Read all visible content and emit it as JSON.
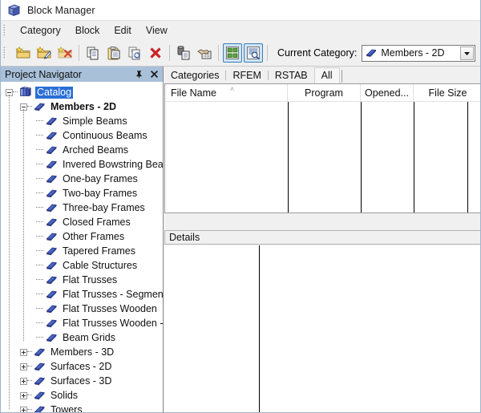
{
  "window": {
    "title": "Block Manager",
    "icon": "block-cabinet-icon"
  },
  "menubar": {
    "items": [
      {
        "label": "Category"
      },
      {
        "label": "Block"
      },
      {
        "label": "Edit"
      },
      {
        "label": "View"
      }
    ]
  },
  "toolbar": {
    "buttons": [
      {
        "name": "new-category-button",
        "icon": "folder-new-icon",
        "pressed": false
      },
      {
        "name": "edit-category-button",
        "icon": "folder-edit-icon",
        "pressed": false
      },
      {
        "name": "delete-category-button",
        "icon": "folder-delete-icon",
        "pressed": false
      },
      {
        "name": "copy-button",
        "icon": "copy-icon",
        "pressed": false
      },
      {
        "name": "paste-button",
        "icon": "paste-icon",
        "pressed": false
      },
      {
        "name": "duplicate-button",
        "icon": "duplicate-icon",
        "pressed": false
      },
      {
        "name": "delete-button",
        "icon": "red-x-icon",
        "pressed": false
      },
      {
        "name": "import-block-button",
        "icon": "block-import-icon",
        "pressed": false
      },
      {
        "name": "export-block-button",
        "icon": "handshake-table-icon",
        "pressed": false
      },
      {
        "name": "thumbnail-view-button",
        "icon": "grid-view-icon",
        "pressed": true
      },
      {
        "name": "details-view-button",
        "icon": "list-search-icon",
        "pressed": true
      }
    ],
    "current_category_label": "Current Category:",
    "current_category_value": "Members - 2D",
    "current_category_icon": "blue-book-icon"
  },
  "navigator": {
    "title": "Project Navigator",
    "pin_icon": "pin-icon",
    "close_icon": "close-icon",
    "tree": [
      {
        "label": "Catalog",
        "depth": 0,
        "icon": "books-stack-icon",
        "expander": "minus",
        "selected": true,
        "bold": false
      },
      {
        "label": "Members - 2D",
        "depth": 1,
        "icon": "blue-book-icon",
        "expander": "minus",
        "selected": false,
        "bold": true
      },
      {
        "label": "Simple Beams",
        "depth": 2,
        "icon": "blue-book-icon",
        "expander": "none",
        "selected": false,
        "bold": false
      },
      {
        "label": "Continuous Beams",
        "depth": 2,
        "icon": "blue-book-icon",
        "expander": "none",
        "selected": false,
        "bold": false
      },
      {
        "label": "Arched Beams",
        "depth": 2,
        "icon": "blue-book-icon",
        "expander": "none",
        "selected": false,
        "bold": false
      },
      {
        "label": "Invered Bowstring Bear",
        "depth": 2,
        "icon": "blue-book-icon",
        "expander": "none",
        "selected": false,
        "bold": false
      },
      {
        "label": "One-bay Frames",
        "depth": 2,
        "icon": "blue-book-icon",
        "expander": "none",
        "selected": false,
        "bold": false
      },
      {
        "label": "Two-bay Frames",
        "depth": 2,
        "icon": "blue-book-icon",
        "expander": "none",
        "selected": false,
        "bold": false
      },
      {
        "label": "Three-bay Frames",
        "depth": 2,
        "icon": "blue-book-icon",
        "expander": "none",
        "selected": false,
        "bold": false
      },
      {
        "label": "Closed Frames",
        "depth": 2,
        "icon": "blue-book-icon",
        "expander": "none",
        "selected": false,
        "bold": false
      },
      {
        "label": "Other Frames",
        "depth": 2,
        "icon": "blue-book-icon",
        "expander": "none",
        "selected": false,
        "bold": false
      },
      {
        "label": "Tapered Frames",
        "depth": 2,
        "icon": "blue-book-icon",
        "expander": "none",
        "selected": false,
        "bold": false
      },
      {
        "label": "Cable Structures",
        "depth": 2,
        "icon": "blue-book-icon",
        "expander": "none",
        "selected": false,
        "bold": false
      },
      {
        "label": "Flat Trusses",
        "depth": 2,
        "icon": "blue-book-icon",
        "expander": "none",
        "selected": false,
        "bold": false
      },
      {
        "label": "Flat Trusses - Segment",
        "depth": 2,
        "icon": "blue-book-icon",
        "expander": "none",
        "selected": false,
        "bold": false
      },
      {
        "label": "Flat Trusses Wooden",
        "depth": 2,
        "icon": "blue-book-icon",
        "expander": "none",
        "selected": false,
        "bold": false
      },
      {
        "label": "Flat Trusses Wooden -",
        "depth": 2,
        "icon": "blue-book-icon",
        "expander": "none",
        "selected": false,
        "bold": false
      },
      {
        "label": "Beam Grids",
        "depth": 2,
        "icon": "blue-book-icon",
        "expander": "none",
        "selected": false,
        "bold": false
      },
      {
        "label": "Members - 3D",
        "depth": 1,
        "icon": "blue-book-icon",
        "expander": "plus",
        "selected": false,
        "bold": false
      },
      {
        "label": "Surfaces - 2D",
        "depth": 1,
        "icon": "blue-book-icon",
        "expander": "plus",
        "selected": false,
        "bold": false
      },
      {
        "label": "Surfaces - 3D",
        "depth": 1,
        "icon": "blue-book-icon",
        "expander": "plus",
        "selected": false,
        "bold": false
      },
      {
        "label": "Solids",
        "depth": 1,
        "icon": "blue-book-icon",
        "expander": "plus",
        "selected": false,
        "bold": false
      },
      {
        "label": "Towers",
        "depth": 1,
        "icon": "blue-book-icon",
        "expander": "plus",
        "selected": false,
        "bold": false
      }
    ]
  },
  "content": {
    "tabs": [
      {
        "label": "Categories",
        "selected": false
      },
      {
        "label": "RFEM",
        "selected": false
      },
      {
        "label": "RSTAB",
        "selected": false
      },
      {
        "label": "All",
        "selected": true
      }
    ],
    "columns": [
      {
        "label": "File Name",
        "sorted": true,
        "sort_caret": "˄"
      },
      {
        "label": "Program",
        "sorted": false,
        "sort_caret": ""
      },
      {
        "label": "Opened...",
        "sorted": false,
        "sort_caret": ""
      },
      {
        "label": "File Size",
        "sorted": false,
        "sort_caret": ""
      }
    ],
    "rows": [],
    "details_title": "Details"
  },
  "colors": {
    "selection_blue": "#2a6fd6",
    "navigator_header": "#a8c0d8",
    "toolbar_bg": "#f0f0f0",
    "pressed_button": "#cfe4f7",
    "pressed_border": "#3c7fb1",
    "book_blue": "#4a66c8",
    "folder_yellow": "#f2cf6a",
    "delete_red": "#cc2222"
  }
}
